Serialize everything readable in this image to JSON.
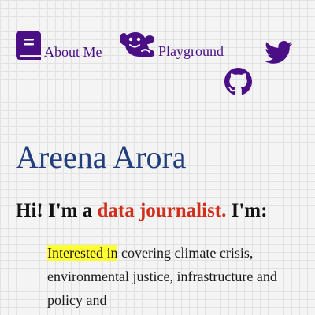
{
  "nav": {
    "about": {
      "label": "About Me",
      "icon": "book-icon"
    },
    "playground": {
      "label": "Playground",
      "icon": "otter-icon"
    },
    "twitter": {
      "icon": "twitter-icon"
    },
    "github": {
      "icon": "github-icon"
    }
  },
  "colors": {
    "nav": "#4b0f85",
    "title": "#213e7d",
    "accent": "#d0301b",
    "highlight": "#ffff33"
  },
  "hero": {
    "title": "Areena Arora",
    "intro_prefix": "Hi! I'm a",
    "role": "data journalist.",
    "intro_suffix": "I'm:",
    "interest_highlight": "Interested in",
    "interest_text": "covering climate crisis, environmental justice, infrastructure and policy and"
  }
}
